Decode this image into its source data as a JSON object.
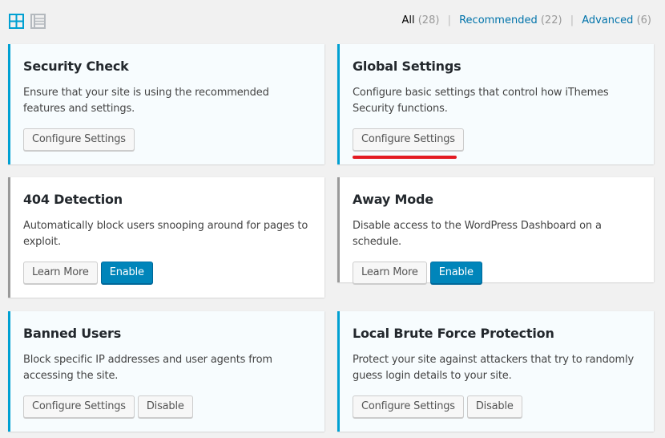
{
  "toolbar": {
    "views": [
      {
        "name": "grid-view",
        "icon": "grid-icon",
        "active": true
      },
      {
        "name": "list-view",
        "icon": "list-icon",
        "active": false
      }
    ],
    "filters": {
      "all": {
        "label": "All",
        "count": "(28)"
      },
      "recommended": {
        "label": "Recommended",
        "count": "(22)"
      },
      "advanced": {
        "label": "Advanced",
        "count": "(6)"
      },
      "separator": "|"
    }
  },
  "colors": {
    "active_border": "#00a0d2",
    "inactive_border": "#999999",
    "primary_button": "#0085ba",
    "link": "#0073aa",
    "highlight_underline": "#e31b23"
  },
  "modules": [
    {
      "title": "Security Check",
      "description": "Ensure that your site is using the recommended features and settings.",
      "active": true,
      "buttons": [
        "Configure Settings"
      ]
    },
    {
      "title": "Global Settings",
      "description": "Configure basic settings that control how iThemes Security functions.",
      "active": true,
      "buttons": [
        "Configure Settings"
      ],
      "highlighted": true
    },
    {
      "title": "404 Detection",
      "description": "Automatically block users snooping around for pages to exploit.",
      "active": false,
      "buttons": [
        "Learn More",
        "Enable"
      ]
    },
    {
      "title": "Away Mode",
      "description": "Disable access to the WordPress Dashboard on a schedule.",
      "active": false,
      "buttons": [
        "Learn More",
        "Enable"
      ]
    },
    {
      "title": "Banned Users",
      "description": "Block specific IP addresses and user agents from accessing the site.",
      "active": true,
      "buttons": [
        "Configure Settings",
        "Disable"
      ]
    },
    {
      "title": "Local Brute Force Protection",
      "description": "Protect your site against attackers that try to randomly guess login details to your site.",
      "active": true,
      "buttons": [
        "Configure Settings",
        "Disable"
      ]
    }
  ]
}
